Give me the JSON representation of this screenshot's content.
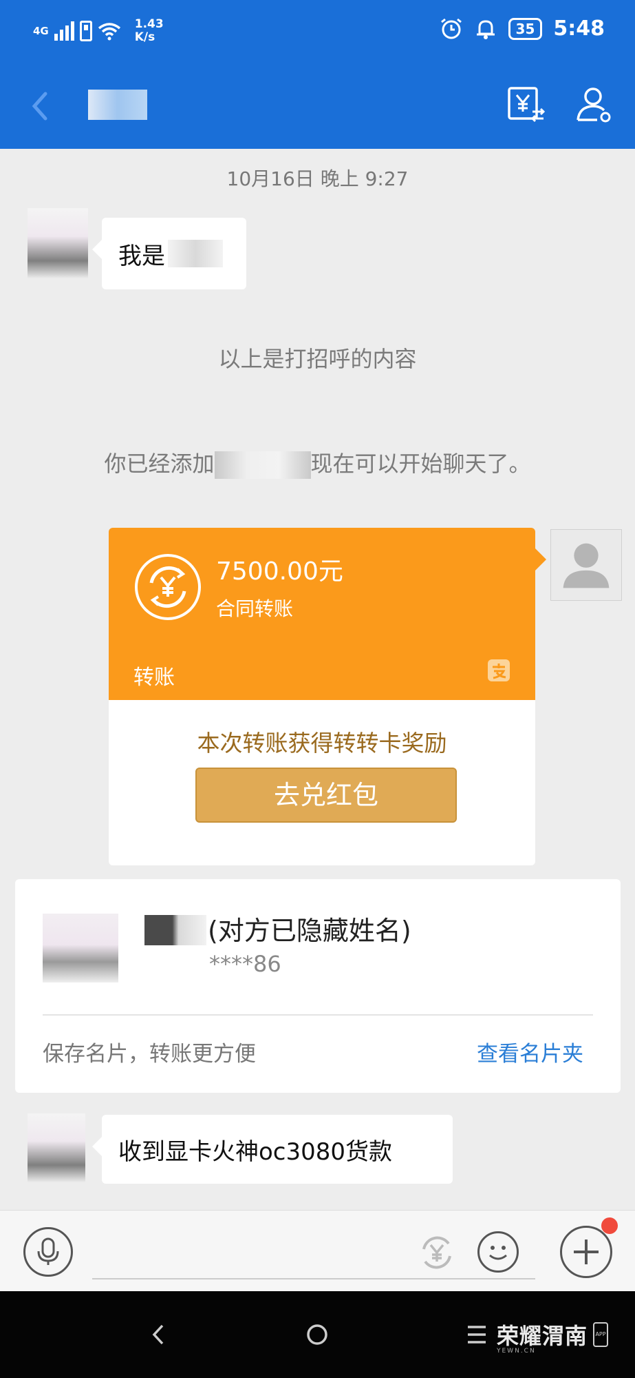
{
  "status_bar": {
    "network": "4G",
    "speed_value": "1.43",
    "speed_unit": "K/s",
    "battery": "35",
    "time": "5:48"
  },
  "header": {
    "icons": [
      "back-icon",
      "transfer-yen-icon",
      "profile-icon"
    ]
  },
  "chat": {
    "timestamp": "10月16日 晚上 9:27",
    "greeting_message": "我是",
    "greeting_note": "以上是打招呼的内容",
    "added_note_prefix": "你已经添加",
    "added_note_suffix": "现在可以开始聊天了。",
    "transfer": {
      "amount": "7500.00元",
      "description": "合同转账",
      "label": "转账",
      "reward_text": "本次转账获得转转卡奖励",
      "button_label": "去兑红包",
      "colors": {
        "card": "#fb9a1b",
        "button": "#e0aa55",
        "reward_text": "#9a6a1f"
      }
    },
    "contact_card": {
      "name_note": "(对方已隐藏姓名)",
      "account": "****86",
      "save_text": "保存名片，转账更方便",
      "view_link": "查看名片夹",
      "link_color": "#2a7ed6"
    },
    "last_message": "收到显卡火神oc3080货款"
  },
  "input_bar": {
    "icons": [
      "microphone-icon",
      "yen-icon",
      "smile-icon",
      "plus-icon"
    ]
  },
  "nav_bar": {
    "icons": [
      "back-nav-icon",
      "home-nav-icon",
      "menu-nav-icon"
    ],
    "watermark": "荣耀渭南",
    "watermark_url": "YEWN.CN",
    "watermark_app": "APP"
  },
  "colors": {
    "primary": "#1a6fd8",
    "background": "#ededed"
  }
}
